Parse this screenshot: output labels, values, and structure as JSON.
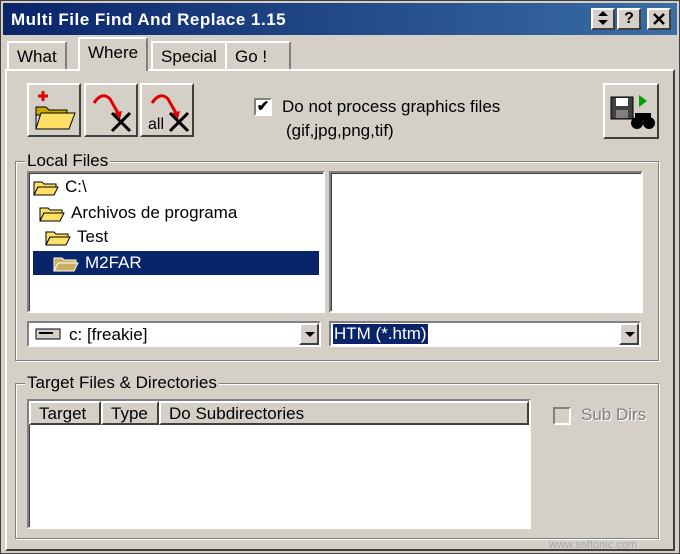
{
  "window": {
    "title": "Multi File Find And Replace 1.15",
    "title_buttons": [
      "?",
      "?",
      "x"
    ]
  },
  "tabs": [
    {
      "label": "What",
      "active": false
    },
    {
      "label": "Where",
      "active": true
    },
    {
      "label": "Special",
      "active": false
    },
    {
      "label": "Go !",
      "active": false
    }
  ],
  "toolbar": {
    "add_folder_icon": "add-folder-icon",
    "remove_icon": "remove-selected-icon",
    "remove_all_icon": "remove-all-icon",
    "remove_all_label": "all",
    "save_search_icon": "save-search-icon"
  },
  "options": {
    "no_graphics_label": "Do not process graphics files",
    "no_graphics_sub": "(gif,jpg,png,tif)",
    "no_graphics_checked": "✔"
  },
  "local_files": {
    "label": "Local Files",
    "tree": [
      "C:\\",
      "Archivos de programa",
      "Test",
      "M2FAR"
    ],
    "selected_index": 3,
    "drive": "c: [freakie]",
    "filter": "HTM (*.htm)"
  },
  "target": {
    "label": "Target Files & Directories",
    "columns": [
      "Target",
      "Type",
      "Do Subdirectories"
    ],
    "sub_dirs_label": "Sub Dirs"
  },
  "watermark": "www.softonic.com"
}
